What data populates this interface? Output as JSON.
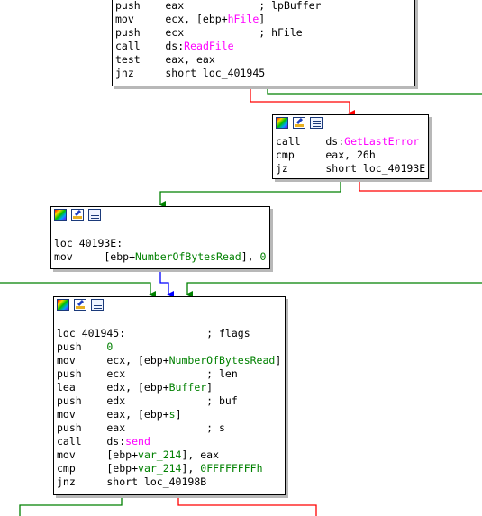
{
  "colors": {
    "code": "#000000",
    "symbol": "#008000",
    "api": "#ff00ff",
    "edge_true": "#008000",
    "edge_false": "#ff0000",
    "edge_uncond": "#0000ff"
  },
  "node1": {
    "lines": [
      [
        {
          "t": "push    eax            ; ",
          "c": "k"
        },
        {
          "t": "lpBuffer",
          "c": "k"
        }
      ],
      [
        {
          "t": "mov     ecx, [ebp+",
          "c": "k"
        },
        {
          "t": "hFile",
          "c": "m"
        },
        {
          "t": "]",
          "c": "k"
        }
      ],
      [
        {
          "t": "push    ecx            ; hFile",
          "c": "k"
        }
      ],
      [
        {
          "t": "call    ds:",
          "c": "k"
        },
        {
          "t": "ReadFile",
          "c": "m"
        }
      ],
      [
        {
          "t": "test    eax, eax",
          "c": "k"
        }
      ],
      [
        {
          "t": "jnz     short loc_401945",
          "c": "k"
        }
      ]
    ]
  },
  "node2": {
    "lines": [
      [
        {
          "t": "call    ds:",
          "c": "k"
        },
        {
          "t": "GetLastError",
          "c": "m"
        }
      ],
      [
        {
          "t": "cmp     eax, 26h",
          "c": "k"
        }
      ],
      [
        {
          "t": "jz      short loc_40193E",
          "c": "k"
        }
      ]
    ]
  },
  "node3": {
    "lines": [
      [
        {
          "t": "",
          "c": "k"
        }
      ],
      [
        {
          "t": "loc_40193E:",
          "c": "k"
        }
      ],
      [
        {
          "t": "mov     [ebp+",
          "c": "k"
        },
        {
          "t": "NumberOfBytesRead",
          "c": "g"
        },
        {
          "t": "], ",
          "c": "k"
        },
        {
          "t": "0",
          "c": "g"
        }
      ]
    ]
  },
  "node4": {
    "lines": [
      [
        {
          "t": "",
          "c": "k"
        }
      ],
      [
        {
          "t": "loc_401945:             ; flags",
          "c": "k"
        }
      ],
      [
        {
          "t": "push    ",
          "c": "k"
        },
        {
          "t": "0",
          "c": "g"
        }
      ],
      [
        {
          "t": "mov     ecx, [ebp+",
          "c": "k"
        },
        {
          "t": "NumberOfBytesRead",
          "c": "g"
        },
        {
          "t": "]",
          "c": "k"
        }
      ],
      [
        {
          "t": "push    ecx             ; len",
          "c": "k"
        }
      ],
      [
        {
          "t": "lea     edx, [ebp+",
          "c": "k"
        },
        {
          "t": "Buffer",
          "c": "g"
        },
        {
          "t": "]",
          "c": "k"
        }
      ],
      [
        {
          "t": "push    edx             ; buf",
          "c": "k"
        }
      ],
      [
        {
          "t": "mov     eax, [ebp+",
          "c": "k"
        },
        {
          "t": "s",
          "c": "g"
        },
        {
          "t": "]",
          "c": "k"
        }
      ],
      [
        {
          "t": "push    eax             ; s",
          "c": "k"
        }
      ],
      [
        {
          "t": "call    ds:",
          "c": "k"
        },
        {
          "t": "send",
          "c": "m"
        }
      ],
      [
        {
          "t": "mov     [ebp+",
          "c": "k"
        },
        {
          "t": "var_214",
          "c": "g"
        },
        {
          "t": "], eax",
          "c": "k"
        }
      ],
      [
        {
          "t": "cmp     [ebp+",
          "c": "k"
        },
        {
          "t": "var_214",
          "c": "g"
        },
        {
          "t": "], ",
          "c": "k"
        },
        {
          "t": "0FFFFFFFFh",
          "c": "g"
        }
      ],
      [
        {
          "t": "jnz     short loc_40198B",
          "c": "k"
        }
      ]
    ]
  }
}
